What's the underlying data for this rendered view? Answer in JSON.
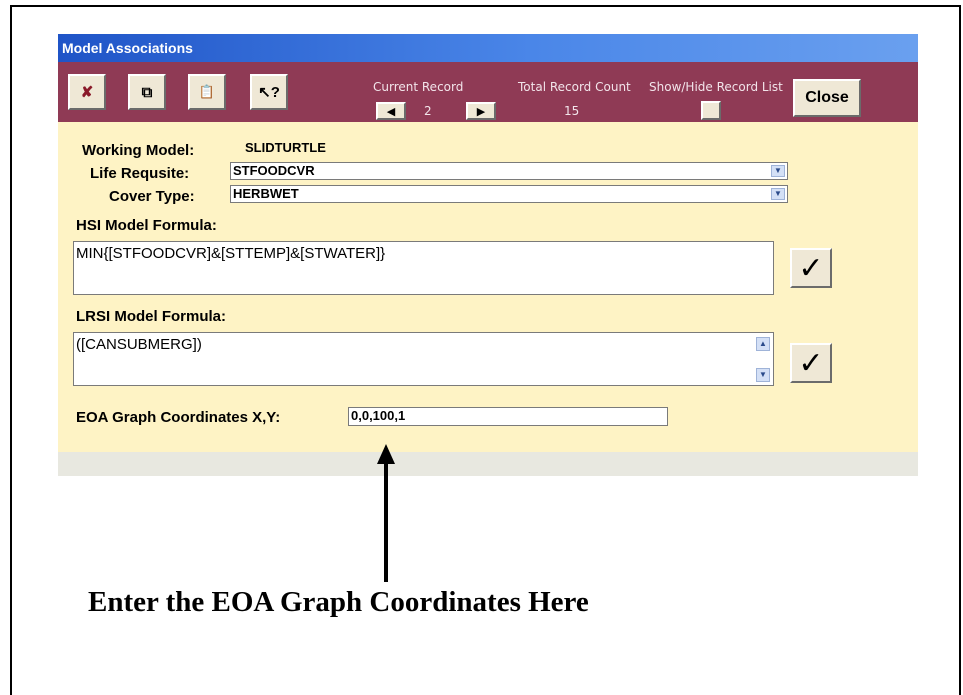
{
  "window": {
    "title": "Model Associations"
  },
  "toolbar": {
    "delete_icon": "✘",
    "copy_icon": "⧉",
    "paste_icon": "📋",
    "help_icon": "↖?",
    "current_record_label": "Current Record",
    "current_record_value": "2",
    "total_label": "Total Record Count",
    "total_value": "15",
    "show_hide_label": "Show/Hide Record List",
    "close_label": "Close"
  },
  "form": {
    "working_model_label": "Working Model:",
    "working_model_value": "SLIDTURTLE",
    "life_requisite_label": "Life Requsite:",
    "life_requisite_value": "STFOODCVR",
    "cover_type_label": "Cover Type:",
    "cover_type_value": "HERBWET",
    "hsi_label": "HSI Model Formula:",
    "hsi_value": "MIN{[STFOODCVR]&[STTEMP]&[STWATER]}",
    "lrsi_label": "LRSI Model Formula:",
    "lrsi_value": "([CANSUBMERG])",
    "eoa_label": "EOA Graph Coordinates X,Y:",
    "eoa_value": "0,0,100,1",
    "validate_icon": "✓"
  },
  "annotation": {
    "text": "Enter the EOA Graph Coordinates Here"
  }
}
